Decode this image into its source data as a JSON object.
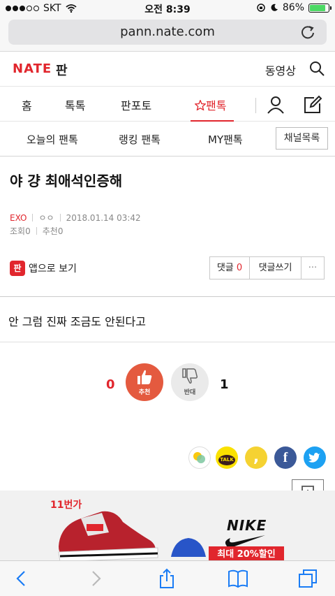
{
  "status_bar": {
    "carrier": "SKT",
    "time": "오전 8:39",
    "battery": "86%",
    "battery_level": 0.86
  },
  "url_bar": {
    "url": "pann.nate.com"
  },
  "header": {
    "logo": "NATE",
    "logo_sub": "판",
    "video_link": "동영상"
  },
  "main_nav": {
    "items": [
      "홈",
      "톡톡",
      "판포토",
      "팬톡"
    ],
    "active": "팬톡"
  },
  "sub_nav": {
    "items": [
      "오늘의 팬톡",
      "랭킹 팬톡",
      "MY팬톡"
    ],
    "channel_list": "채널목록"
  },
  "post": {
    "title": "야 걍 최애석인증해",
    "category": "EXO",
    "author": "ㅇㅇ",
    "date": "2018.01.14 03:42",
    "views_label": "조회",
    "views": "0",
    "recommend_label": "추천",
    "recommend": "0",
    "content": "안 그럼 진짜 조금도 안된다고"
  },
  "actions": {
    "app_view": "앱으로 보기",
    "app_icon_text": "판",
    "comment_label": "댓글",
    "comment_count": "0",
    "write_comment": "댓글쓰기",
    "more": "···"
  },
  "vote": {
    "up_count": "0",
    "up_label": "추천",
    "down_label": "반대",
    "down_count": "1"
  },
  "share": {
    "kakao_talk_text": "TALK"
  },
  "ad": {
    "brand_11st": "11번가",
    "brand_nike": "NIKE",
    "sale_text": "최대 20%할인"
  },
  "colors": {
    "accent": "#e1262d",
    "up_vote": "#e45a3f",
    "facebook": "#3b5998",
    "twitter": "#1da1f2",
    "kakao": "#fae100"
  }
}
